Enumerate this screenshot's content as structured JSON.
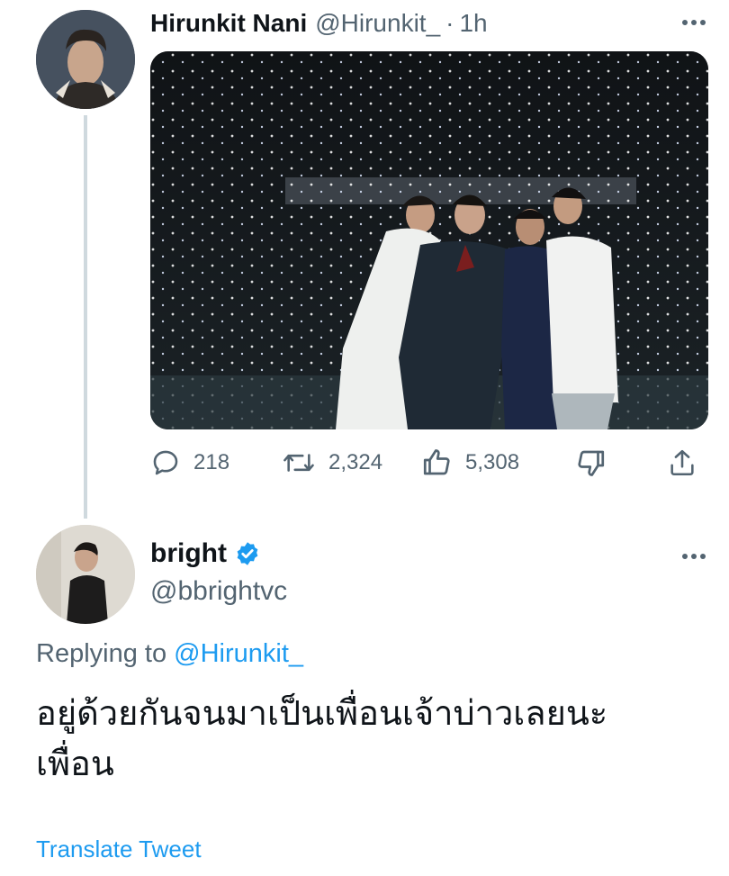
{
  "tweet": {
    "author_name": "Hirunkit Nani",
    "author_handle": "@Hirunkit_",
    "separator": "·",
    "time": "1h",
    "media_alt": "photo",
    "actions": {
      "replies": "218",
      "retweets": "2,324",
      "likes": "5,308"
    }
  },
  "reply": {
    "author_name": "bright",
    "verified": true,
    "author_handle": "@bbrightvc",
    "replying_prefix": "Replying to",
    "replying_to": "@Hirunkit_",
    "text": "อยู่ด้วยกันจนมาเป็นเพื่อนเจ้าบ่าวเลยนะเพื่อน",
    "translate_label": "Translate Tweet"
  },
  "colors": {
    "accent": "#1d9bf0",
    "secondary_text": "#536471",
    "primary_text": "#0f1419",
    "thread_line": "#cfd9de"
  },
  "icons": [
    "more-icon",
    "reply-icon",
    "retweet-icon",
    "like-icon",
    "dislike-icon",
    "share-icon",
    "verified-badge-icon"
  ]
}
